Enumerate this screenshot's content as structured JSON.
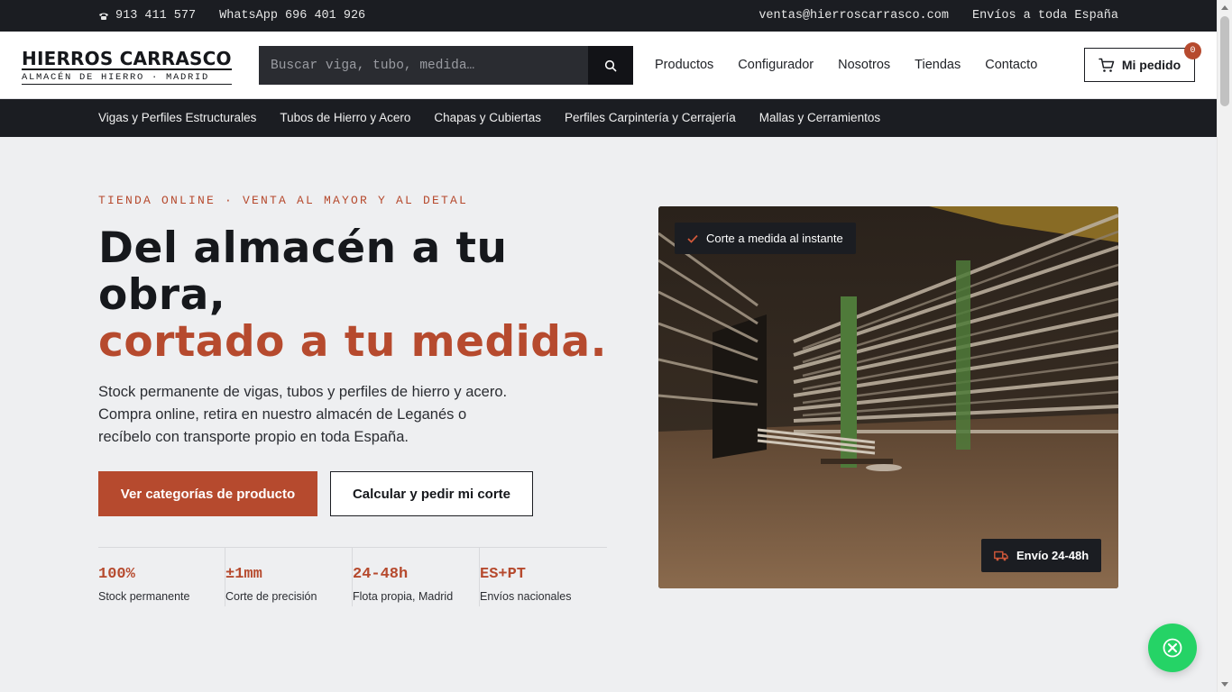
{
  "topbar": {
    "phone": "913 411 577",
    "whatsapp": "WhatsApp 696 401 926",
    "email": "ventas@hierroscarrasco.com",
    "shipping": "Envíos a toda España"
  },
  "header": {
    "logo_name": "HIERROS CARRASCO",
    "logo_sub": "ALMACÉN DE HIERRO · MADRID",
    "search_placeholder": "Buscar viga, tubo, medida…",
    "nav": [
      "Productos",
      "Configurador",
      "Nosotros",
      "Tiendas",
      "Contacto"
    ],
    "cart_label": "Mi pedido",
    "cart_count": "0"
  },
  "categories": [
    "Vigas y Perfiles Estructurales",
    "Tubos de Hierro y Acero",
    "Chapas y Cubiertas",
    "Perfiles Carpintería y Cerrajería",
    "Mallas y Cerramientos"
  ],
  "hero": {
    "eyebrow": "TIENDA ONLINE · VENTA AL MAYOR Y AL DETAL",
    "headline_1": "Del almacén a tu obra,",
    "headline_accent": "cortado a tu medida.",
    "lead": "Stock permanente de vigas, tubos y perfiles de hierro y acero. Compra online, retira en nuestro almacén de Leganés o recíbelo con transporte propio en toda España.",
    "primary_cta": "Ver categorías de producto",
    "secondary_cta": "Calcular y pedir mi corte",
    "stats": [
      {
        "value": "100%",
        "label": "Stock permanente"
      },
      {
        "value": "±1mm",
        "label": "Corte de precisión"
      },
      {
        "value": "24-48h",
        "label": "Flota propia, Madrid"
      },
      {
        "value": "ES+PT",
        "label": "Envíos nacionales"
      }
    ],
    "image_tag_top": "Corte a medida al instante",
    "image_tag_bottom": "Envío 24-48h"
  },
  "colors": {
    "accent": "#b64a2e",
    "dark": "#1b1d22",
    "background": "#eeeff1",
    "whatsapp": "#25d366"
  },
  "icons": {
    "phone": "phone-icon",
    "search": "search-icon",
    "cart": "cart-icon",
    "check": "check-icon",
    "truck": "truck-icon",
    "whatsapp": "whatsapp-icon"
  }
}
